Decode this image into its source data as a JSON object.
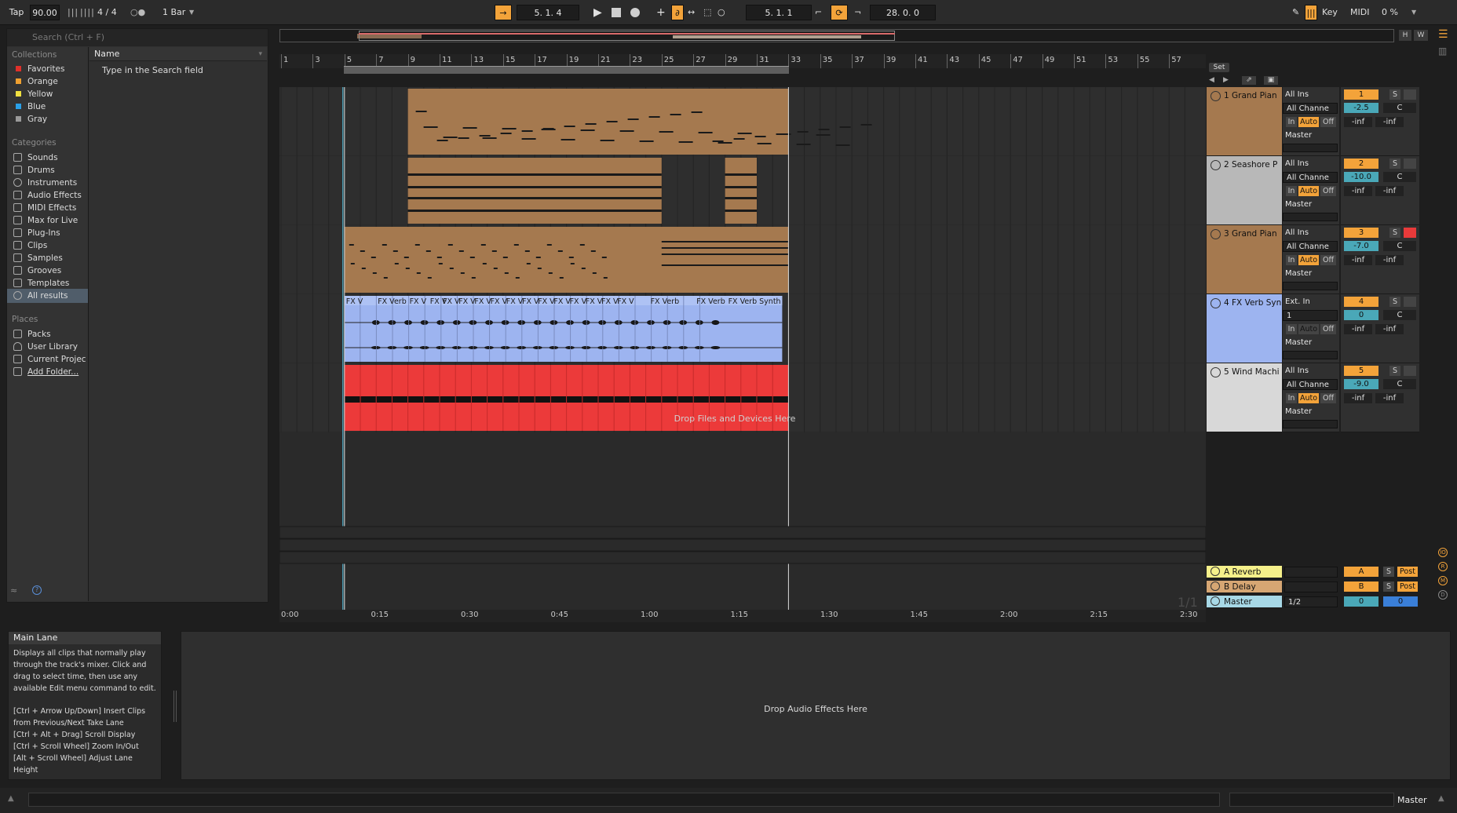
{
  "transport": {
    "tap": "Tap",
    "tempo": "90.00",
    "signature": "4 / 4",
    "quantize": "1 Bar",
    "position": "5.  1.  4",
    "loop_start": "5.  1.  1",
    "loop_length": "28.  0.  0",
    "key": "Key",
    "midi": "MIDI",
    "cpu": "0 %"
  },
  "browser": {
    "search_placeholder": "Search (Ctrl + F)",
    "collections_title": "Collections",
    "collections": [
      {
        "label": "Favorites",
        "color": "#e0302a"
      },
      {
        "label": "Orange",
        "color": "#f0a030"
      },
      {
        "label": "Yellow",
        "color": "#f0e040"
      },
      {
        "label": "Blue",
        "color": "#2aa0e8"
      },
      {
        "label": "Gray",
        "color": "#9a9a9a"
      }
    ],
    "categories_title": "Categories",
    "categories": [
      "Sounds",
      "Drums",
      "Instruments",
      "Audio Effects",
      "MIDI Effects",
      "Max for Live",
      "Plug-Ins",
      "Clips",
      "Samples",
      "Grooves",
      "Templates",
      "All results"
    ],
    "places_title": "Places",
    "places": [
      "Packs",
      "User Library",
      "Current Projec",
      "Add Folder..."
    ],
    "name_header": "Name",
    "empty_hint": "Type in the Search field"
  },
  "ruler": {
    "bars": [
      "1",
      "3",
      "5",
      "7",
      "9",
      "11",
      "13",
      "15",
      "17",
      "19",
      "21",
      "23",
      "25",
      "27",
      "29",
      "31",
      "33",
      "35",
      "37",
      "39",
      "41",
      "43",
      "45",
      "47",
      "49",
      "51",
      "53",
      "55",
      "57"
    ],
    "set_label": "Set"
  },
  "timeline": [
    "0:00",
    "0:15",
    "0:30",
    "0:45",
    "1:00",
    "1:15",
    "1:30",
    "1:45",
    "2:00",
    "2:15",
    "2:30"
  ],
  "tracks": [
    {
      "name": "1 Grand Pian",
      "color": "#a5794f",
      "input": "All Ins",
      "channel": "All Channe",
      "num": "1",
      "vol": "-2.5",
      "pan": "C",
      "out": "Master"
    },
    {
      "name": "2 Seashore P",
      "color": "#b8b8b8",
      "input": "All Ins",
      "channel": "All Channe",
      "num": "2",
      "vol": "-10.0",
      "pan": "C",
      "out": "Master"
    },
    {
      "name": "3 Grand Pian",
      "color": "#a5794f",
      "input": "All Ins",
      "channel": "All Channe",
      "num": "3",
      "vol": "-7.0",
      "pan": "C",
      "out": "Master"
    },
    {
      "name": "4 FX Verb Syn",
      "color": "#9db4f0",
      "input": "Ext. In",
      "channel": "1",
      "num": "4",
      "vol": "0",
      "pan": "C",
      "out": "Master"
    },
    {
      "name": "5 Wind Machi",
      "color": "#d8d8d8",
      "input": "All Ins",
      "channel": "All Channe",
      "num": "5",
      "vol": "-9.0",
      "pan": "C",
      "out": "Master"
    }
  ],
  "track_buttons": {
    "in": "In",
    "auto": "Auto",
    "off": "Off",
    "solo": "S",
    "inf": "-inf"
  },
  "clip_label_fx": "FX Verb Synth",
  "clip_label_fx_short": "FX V",
  "clip_label_fx_verb": "FX Verb",
  "drop_files": "Drop Files and Devices Here",
  "returns": [
    {
      "name": "A Reverb",
      "letter": "A",
      "color": "#f5f08a",
      "post": "Post"
    },
    {
      "name": "B Delay",
      "letter": "B",
      "color": "#d6a673",
      "post": "Post"
    }
  ],
  "master": {
    "name": "Master",
    "out": "1/2",
    "vol": "0",
    "pan": "0",
    "color": "#a7d8e6"
  },
  "page_indicator": "1/1",
  "overview_buttons": {
    "h": "H",
    "w": "W"
  },
  "info": {
    "title": "Main Lane",
    "body": "Displays all clips that normally play through the track's mixer. Click and drag to select time, then use any available Edit menu command to edit.",
    "shortcuts": [
      "[Ctrl + Arrow Up/Down] Insert Clips from Previous/Next Take Lane",
      "[Ctrl + Alt + Drag] Scroll Display",
      "[Ctrl + Scroll Wheel] Zoom In/Out",
      "[Alt + Scroll Wheel] Adjust Lane Height"
    ]
  },
  "drop_audio_effects": "Drop Audio Effects Here",
  "status_track": "Master"
}
